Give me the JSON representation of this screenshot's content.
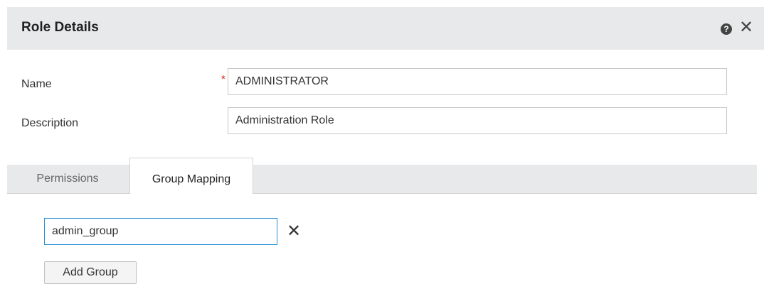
{
  "dialog": {
    "title": "Role Details",
    "help_icon": "question-circle-icon",
    "help_glyph": "?",
    "close_icon": "close-icon",
    "close_glyph": "✕"
  },
  "form": {
    "name_label": "Name",
    "required_mark": "*",
    "name_value": "ADMINISTRATOR",
    "description_label": "Description",
    "description_value": "Administration Role"
  },
  "tabs": [
    {
      "label": "Permissions",
      "active": false
    },
    {
      "label": "Group Mapping",
      "active": true
    }
  ],
  "group_mapping": {
    "groups": [
      {
        "value": "admin_group",
        "remove_glyph": "✕"
      }
    ],
    "add_button_label": "Add Group"
  },
  "colors": {
    "header_bg": "#e8e9ea",
    "required": "#d9281f",
    "focus_border": "#2a8fd6"
  }
}
